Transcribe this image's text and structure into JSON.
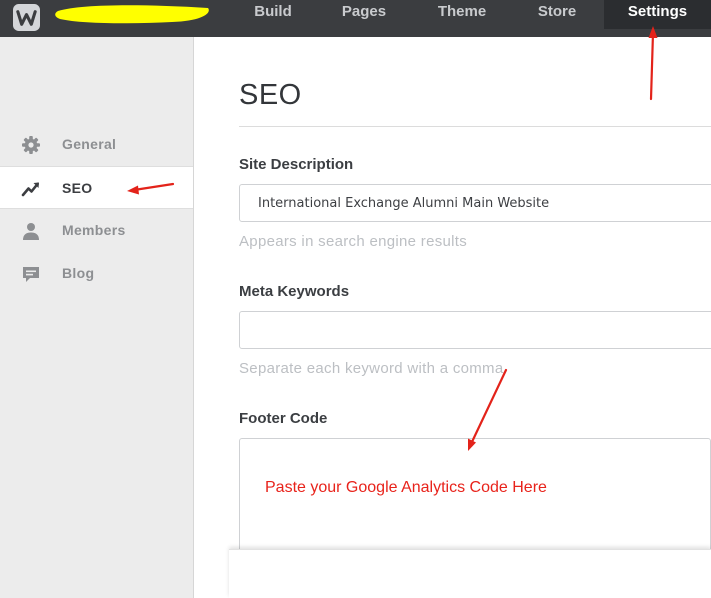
{
  "topbar": {
    "logo_icon": "weebly-w-icon",
    "highlight_color": "#ffff00",
    "nav": [
      {
        "label": "Build"
      },
      {
        "label": "Pages"
      },
      {
        "label": "Theme"
      },
      {
        "label": "Store"
      },
      {
        "label": "Settings",
        "active": true
      }
    ]
  },
  "sidebar": {
    "items": [
      {
        "label": "General",
        "icon": "gear-icon"
      },
      {
        "label": "SEO",
        "icon": "trend-up-icon",
        "active": true
      },
      {
        "label": "Members",
        "icon": "person-icon"
      },
      {
        "label": "Blog",
        "icon": "comment-icon"
      }
    ]
  },
  "main": {
    "title": "SEO",
    "site_description": {
      "label": "Site Description",
      "value": "International Exchange Alumni Main Website",
      "help": "Appears in search engine results"
    },
    "meta_keywords": {
      "label": "Meta Keywords",
      "value": "",
      "help": "Separate each keyword with a comma"
    },
    "footer_code": {
      "label": "Footer Code",
      "annotation": "Paste your Google Analytics Code Here"
    }
  },
  "colors": {
    "topbar_bg": "#3b3d40",
    "annotation_red": "#e8231b"
  }
}
